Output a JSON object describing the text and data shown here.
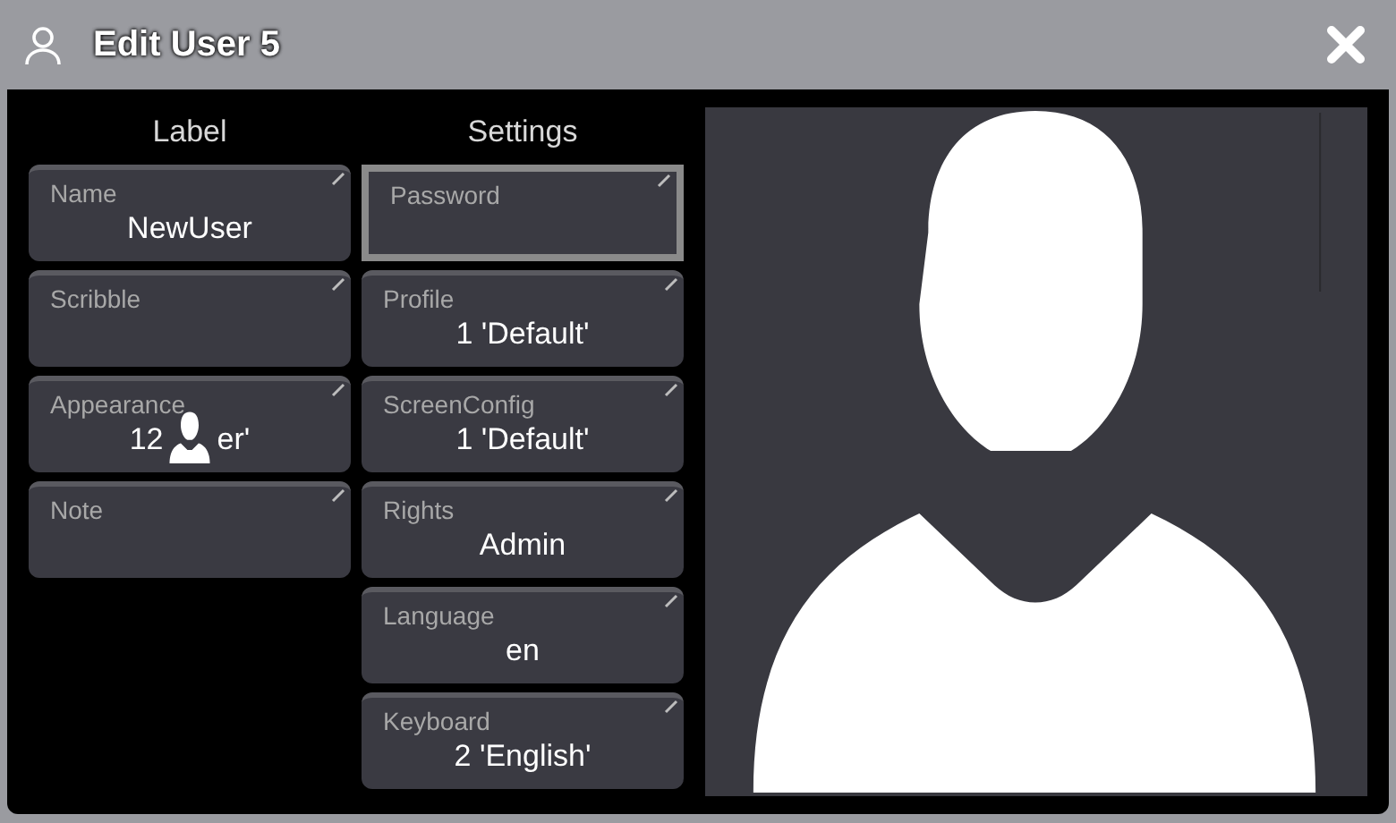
{
  "window": {
    "title": "Edit User 5"
  },
  "columns": [
    {
      "heading": "Label",
      "fields": [
        {
          "label": "Name",
          "value": "NewUser",
          "selected": false
        },
        {
          "label": "Scribble",
          "selected": false
        },
        {
          "label": "Appearance",
          "value_parts": [
            "12",
            "er'"
          ],
          "selected": false
        },
        {
          "label": "Note",
          "selected": false
        }
      ]
    },
    {
      "heading": "Settings",
      "fields": [
        {
          "label": "Password",
          "selected": true
        },
        {
          "label": "Profile",
          "value": "1 'Default'",
          "selected": false
        },
        {
          "label": "ScreenConfig",
          "value": "1 'Default'",
          "selected": false
        },
        {
          "label": "Rights",
          "value": "Admin",
          "selected": false
        },
        {
          "label": "Language",
          "value": "en",
          "selected": false
        },
        {
          "label": "Keyboard",
          "value": "2 'English'",
          "selected": false
        }
      ]
    }
  ]
}
